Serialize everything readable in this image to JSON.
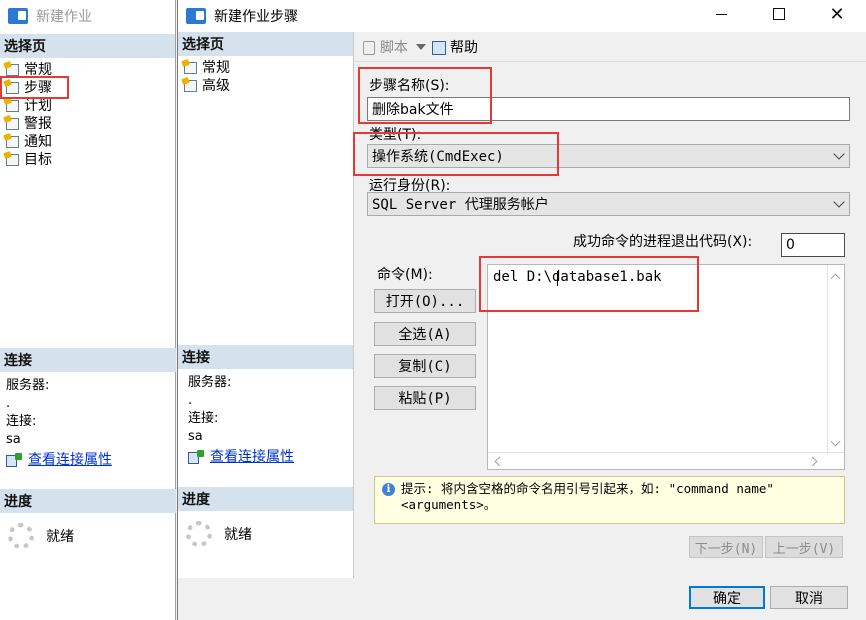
{
  "bg_window": {
    "title": "新建作业",
    "select_page_header": "选择页",
    "pages": [
      "常规",
      "步骤",
      "计划",
      "警报",
      "通知",
      "目标"
    ],
    "connection_header": "连接",
    "server_label": "服务器:",
    "server_value": ".",
    "connection_label": "连接:",
    "connection_value": "sa",
    "view_conn_props": "查看连接属性",
    "progress_header": "进度",
    "progress_status": "就绪"
  },
  "dialog": {
    "title": "新建作业步骤",
    "select_page_header": "选择页",
    "pages": [
      "常规",
      "高级"
    ],
    "connection_header": "连接",
    "server_label": "服务器:",
    "server_value": ".",
    "connection_label": "连接:",
    "connection_value": "sa",
    "view_conn_props": "查看连接属性",
    "progress_header": "进度",
    "progress_status": "就绪",
    "toolbar": {
      "script": "脚本",
      "help": "帮助"
    },
    "step_name_label": "步骤名称(S):",
    "step_name_value": "删除bak文件",
    "type_label": "类型(T):",
    "type_value": "操作系统(CmdExec)",
    "run_as_label": "运行身份(R):",
    "run_as_value": "SQL Server 代理服务帐户",
    "exit_code_label": "成功命令的进程退出代码(X):",
    "exit_code_value": "0",
    "command_label": "命令(M):",
    "command_value": "del D:\\database1.bak",
    "buttons": {
      "open": "打开(O)...",
      "select_all": "全选(A)",
      "copy": "复制(C)",
      "paste": "粘贴(P)"
    },
    "tip": "提示: 将内含空格的命令名用引号引起来，如: \"command name\" <arguments>。",
    "nav": {
      "next": "下一步(N)",
      "prev": "上一步(V)"
    },
    "ok": "确定",
    "cancel": "取消"
  }
}
